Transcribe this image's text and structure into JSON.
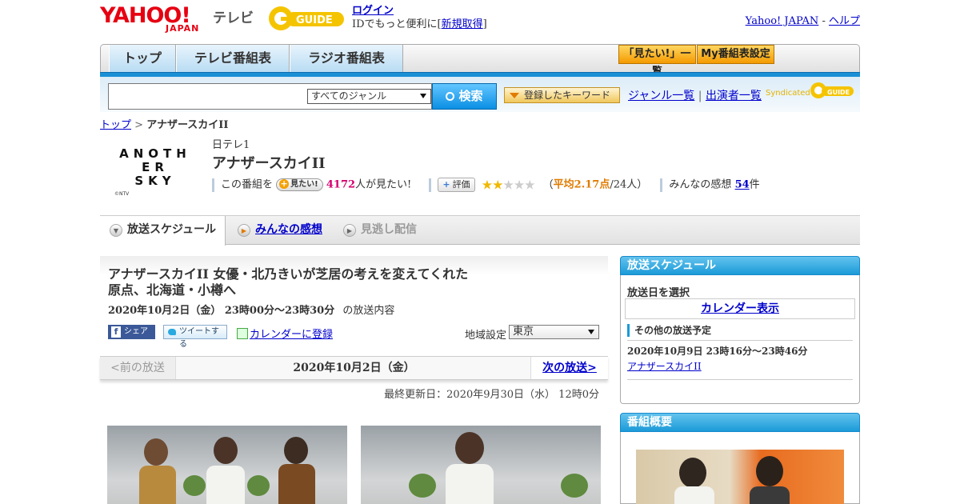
{
  "header": {
    "yahoo_logo": "YAHOO!",
    "yahoo_logo_sub": "JAPAN",
    "tv_label": "テレビ",
    "gguide_logo": "GUIDE",
    "login_link": "ログイン",
    "id_text": "IDでもっと便利に[",
    "register_link": "新規取得",
    "id_close": "]",
    "yahoo_japan_link": "Yahoo! JAPAN",
    "sep": "-",
    "help_link": "ヘルプ"
  },
  "nav": {
    "tabs": [
      "トップ",
      "テレビ番組表",
      "ラジオ番組表"
    ],
    "want_list": "「見たい!」一覧",
    "my_schedule": "My番組表設定"
  },
  "search": {
    "genre_selected": "すべてのジャンル",
    "search_button": "検索",
    "registered_keywords": "登録したキーワード",
    "genre_list_link": "ジャンル一覧",
    "divider": "|",
    "performer_list_link": "出演者一覧",
    "syndicated": "Syndicated"
  },
  "breadcrumb": {
    "top": "トップ",
    "sep": ">",
    "current": "アナザースカイII"
  },
  "program": {
    "logo_lines": [
      "ANOTH",
      "ER",
      "SKY"
    ],
    "logo_copyright": "©NTV",
    "channel": "日テレ1",
    "title": "アナザースカイII",
    "want_prefix": "この番組を",
    "want_button": "見たい!",
    "want_count": "4172",
    "want_suffix": "人が見たい!",
    "rate_button": "評価",
    "rating": 2.17,
    "avg_open": "（",
    "avg_label": "平均2.17点",
    "avg_votes": "/24人）",
    "impressions_label": "みんなの感想",
    "impressions_count": "54",
    "impressions_unit": "件"
  },
  "content_tabs": {
    "schedule": "放送スケジュール",
    "impressions": "みんなの感想",
    "streaming": "見逃し配信"
  },
  "episode": {
    "title_line1": "アナザースカイII 女優・北乃きいが芝居の考えを変えてくれた",
    "title_line2": "原点、北海道・小樽へ",
    "datetime": "2020年10月2日（金） 23時00分～23時30分",
    "datetime_suffix": "の放送内容",
    "share_facebook": "シェア",
    "share_twitter": "ツイートする",
    "calendar_register": "カレンダーに登録",
    "region_label": "地域設定",
    "region_value": "東京"
  },
  "pager": {
    "prev": "<前の放送",
    "date": "2020年10月2日（金）",
    "next": "次の放送>"
  },
  "updated": "最終更新日：2020年9月30日（水） 12時0分",
  "sidebar": {
    "schedule_header": "放送スケジュール",
    "select_date_label": "放送日を選択",
    "calendar_display": "カレンダー表示",
    "other_label": "その他の放送予定",
    "other_time": "2020年10月9日 23時16分～23時46分",
    "other_link": "アナザースカイII",
    "overview_header": "番組概要"
  },
  "colors": {
    "accent_blue": "#1b9ad8",
    "link": "#0000cc",
    "yahoo_red": "#e60012",
    "gguide_yellow": "#f5c400",
    "want_pink": "#d6006f",
    "star": "#f0b800"
  }
}
